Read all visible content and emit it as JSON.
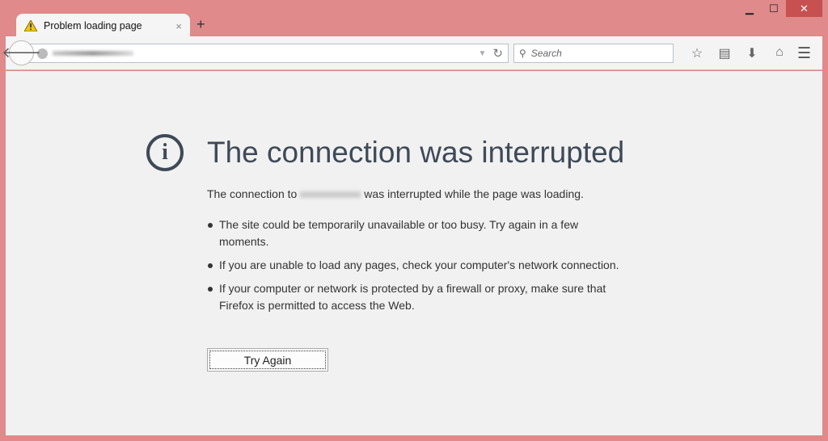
{
  "window": {
    "minimize": "▁",
    "maximize": "☐",
    "close": "✕"
  },
  "tab": {
    "title": "Problem loading page",
    "close": "×",
    "new_tab": "+"
  },
  "toolbar": {
    "search_placeholder": "Search",
    "search_icon": "⚲"
  },
  "error": {
    "title": "The connection was interrupted",
    "desc_before": "The connection to",
    "desc_after": "was interrupted while the page was loading.",
    "bullets": [
      "The site could be temporarily unavailable or too busy. Try again in a few moments.",
      "If you are unable to load any pages, check your computer's network connection.",
      "If your computer or network is protected by a firewall or proxy, make sure that Firefox is permitted to access the Web."
    ],
    "try_again": "Try Again"
  }
}
